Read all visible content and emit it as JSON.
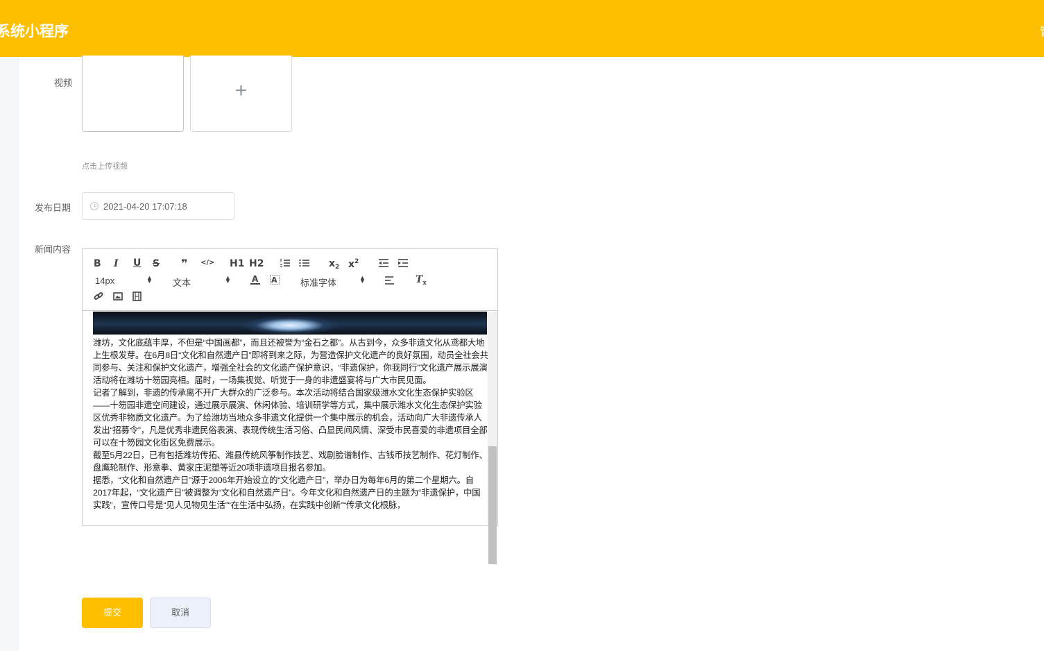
{
  "header": {
    "app_title": "系统小程序",
    "right_text": "管"
  },
  "form": {
    "video": {
      "label": "视频",
      "add_icon": "+",
      "hint": "点击上传视频"
    },
    "date": {
      "label": "发布日期",
      "value": "2021-04-20 17:07:18",
      "icon": "clock-icon"
    },
    "content": {
      "label": "新闻内容",
      "toolbar": {
        "bold": "B",
        "italic": "I",
        "underline": "U",
        "strike": "S",
        "blockquote": "❞",
        "code": "</>",
        "h1": "H1",
        "h2": "H2",
        "subscript": "x",
        "superscript": "x",
        "size_value": "14px",
        "header_value": "文本",
        "font_value": "标准字体",
        "clean": "T"
      },
      "paragraphs": [
        "潍坊，文化底蕴丰厚，不但是“中国画都”，而且还被誉为“金石之都”。从古到今，众多非遗文化从鸢都大地上生根发芽。在6月8日“文化和自然遗产日”即将到来之际，为营造保护文化遗产的良好氛围，动员全社会共同参与、关注和保护文化遗产，增强全社会的文化遗产保护意识，“非遗保护，你我同行”文化遗产展示展演活动将在潍坊十笏园亮相。届时，一场集视觉、听觉于一身的非遗盛宴将与广大市民见面。",
        "记者了解到，非遗的传承离不开广大群众的广泛参与。本次活动将结合国家级潍水文化生态保护实验区——十笏园非遗空间建设，通过展示展演、休闲体验、培训研学等方式，集中展示潍水文化生态保护实验区优秀非物质文化遗产。为了给潍坊当地众多非遗文化提供一个集中展示的机会，活动向广大非遗传承人发出“招募令”，凡是优秀非遗民俗表演、表现传统生活习俗、凸显民间风情、深受市民喜爱的非遗项目全部可以在十笏园文化街区免费展示。",
        "截至5月22日，已有包括潍坊传拓、潍县传统风筝制作技艺、戏剧脸谱制作、古钱币技艺制作、花灯制作、盘鹰轮制作、形意拳、黄家庄泥塑等近20项非遗项目报名参加。",
        "据悉，“文化和自然遗产日”源于2006年开始设立的“文化遗产日”，举办日为每年6月的第二个星期六。自2017年起，“文化遗产日”被调整为“文化和自然遗产日”。今年文化和自然遗产日的主题为“非遗保护，中国实践”，宣传口号是“见人见物见生活”“在生活中弘扬，在实践中创新”“传承文化根脉，"
      ]
    }
  },
  "buttons": {
    "submit": "提交",
    "cancel": "取消"
  },
  "colors": {
    "brand": "#fdbf00",
    "cancel_bg": "#ecf0f8"
  }
}
